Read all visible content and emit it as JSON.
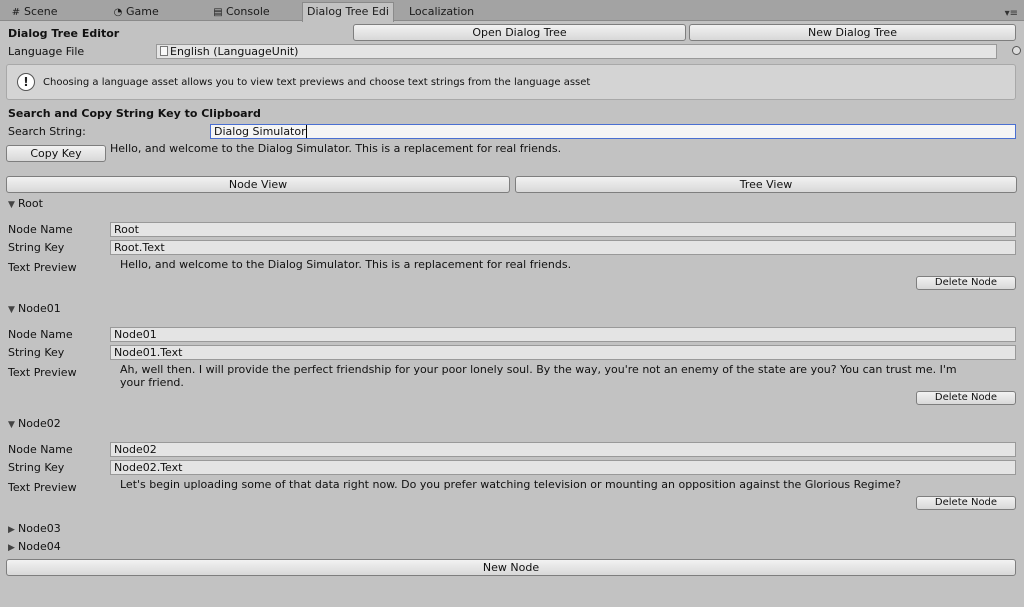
{
  "tabs": [
    {
      "label": "Scene",
      "icon": "grid-icon"
    },
    {
      "label": "Game",
      "icon": "pacman-icon"
    },
    {
      "label": "Console",
      "icon": "console-icon"
    },
    {
      "label": "Dialog Tree Edi",
      "icon": ""
    },
    {
      "label": "Localization",
      "icon": ""
    }
  ],
  "header": {
    "title": "Dialog Tree Editor",
    "open_button": "Open Dialog Tree",
    "new_button": "New Dialog Tree"
  },
  "language": {
    "label": "Language File",
    "value": "English (LanguageUnit)"
  },
  "help": {
    "text": "Choosing a language asset allows you to view text previews and choose text strings from the language asset"
  },
  "search": {
    "section_title": "Search and Copy String Key to Clipboard",
    "label": "Search String:",
    "value": "Dialog Simulator",
    "copy_button": "Copy Key",
    "result": "Hello, and welcome to the Dialog Simulator. This is a replacement for real friends."
  },
  "views": {
    "node_view": "Node View",
    "tree_view": "Tree View"
  },
  "field_labels": {
    "node_name": "Node Name",
    "string_key": "String Key",
    "text_preview": "Text Preview",
    "delete": "Delete Node"
  },
  "nodes": [
    {
      "title": "Root",
      "name": "Root",
      "key": "Root.Text",
      "preview": "Hello, and welcome to the Dialog Simulator. This is a replacement for real friends.",
      "preview2": ""
    },
    {
      "title": "Node01",
      "name": "Node01",
      "key": "Node01.Text",
      "preview": "Ah, well then. I will provide the perfect friendship for your poor lonely soul. By the way, you're not an enemy of the state are you? You can trust me. I'm",
      "preview2": "your friend."
    },
    {
      "title": "Node02",
      "name": "Node02",
      "key": "Node02.Text",
      "preview": "Let's begin uploading some of that data right now. Do you prefer watching television or mounting an opposition against the Glorious Regime?",
      "preview2": ""
    }
  ],
  "collapsed_nodes": [
    "Node03",
    "Node04"
  ],
  "footer": {
    "new_node": "New Node"
  }
}
